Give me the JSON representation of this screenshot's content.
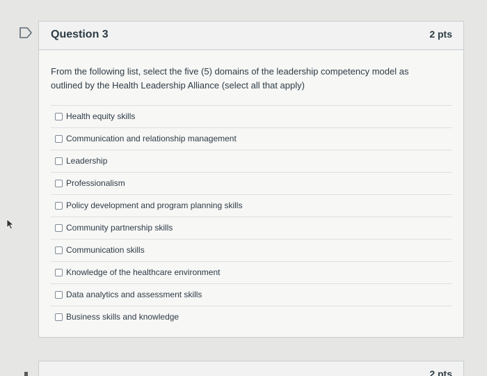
{
  "question": {
    "title": "Question 3",
    "points": "2 pts",
    "text": "From the following list, select the five (5) domains of the leadership competency model as outlined by the Health Leadership Alliance (select all that apply)",
    "answers": [
      {
        "label": "Health equity skills",
        "checked": false
      },
      {
        "label": "Communication and relationship management",
        "checked": false
      },
      {
        "label": "Leadership",
        "checked": false
      },
      {
        "label": "Professionalism",
        "checked": false
      },
      {
        "label": "Policy development and program planning skills",
        "checked": false
      },
      {
        "label": "Community partnership skills",
        "checked": false
      },
      {
        "label": "Communication skills",
        "checked": false
      },
      {
        "label": "Knowledge of the healthcare environment",
        "checked": false
      },
      {
        "label": "Data analytics and assessment skills",
        "checked": false
      },
      {
        "label": "Business skills and knowledge",
        "checked": false
      }
    ]
  },
  "next_question": {
    "points": "2 pts"
  },
  "icons": {
    "flag": "flag-icon",
    "cursor": "mouse-pointer-icon"
  },
  "colors": {
    "text": "#2d3b45",
    "card_background": "#f7f7f6",
    "page_background": "#e6e6e4"
  }
}
